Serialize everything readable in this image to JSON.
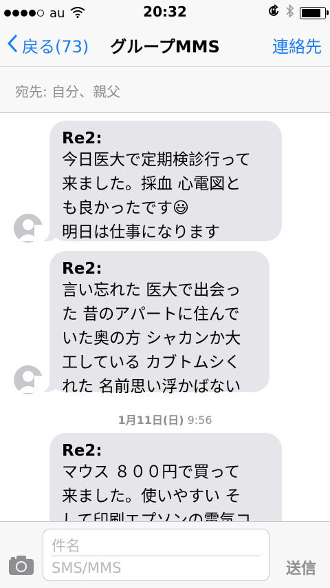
{
  "status_bar": {
    "carrier": "au",
    "time": "20:32",
    "battery_level": 0.9
  },
  "nav": {
    "back_label": "戻る(73)",
    "title": "グループMMS",
    "contacts_label": "連絡先"
  },
  "recipients": {
    "label": "宛先: 自分、親父"
  },
  "messages": [
    {
      "subject": "Re2:",
      "body": "今日医大で定期検診行って\n来ました。採血 心電図と\nも良かったです😃\n明日は仕事になります"
    },
    {
      "subject": "Re2:",
      "body": "言い忘れた 医大で出会っ\nた 昔のアパートに住んで\nいた奥の方 シャカンか大\n工している カブトムシく\nれた 名前思い浮かばない"
    },
    {
      "subject": "Re2:",
      "body": "マウス ８００円で買って\n来ました。使いやすい そ\nして印刷エプソンの電気コ"
    }
  ],
  "timestamp": {
    "date": "1月11日(日)",
    "time": "9:56"
  },
  "compose": {
    "subject_placeholder": "件名",
    "text_placeholder": "SMS/MMS",
    "send_label": "送信"
  },
  "colors": {
    "accent": "#1b7cf5",
    "bubble": "#e5e5ea",
    "muted": "#8e8e93"
  }
}
